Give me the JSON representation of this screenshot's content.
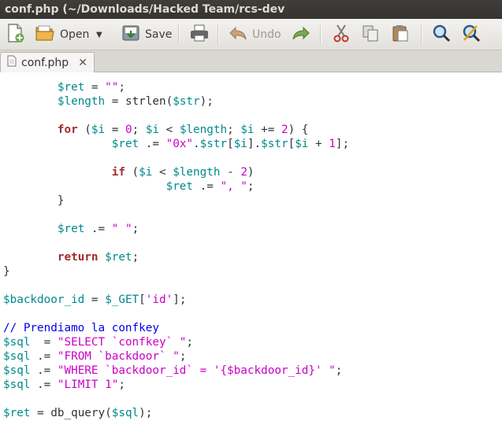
{
  "window": {
    "title": "conf.php (~/Downloads/Hacked Team/rcs-dev"
  },
  "toolbar": {
    "open_label": "Open",
    "save_label": "Save",
    "undo_label": "Undo"
  },
  "tab": {
    "label": "conf.php"
  },
  "editor": {
    "language": "php",
    "lines": [
      "        $ret = \"\";",
      "        $length = strlen($str);",
      "",
      "        for ($i = 0; $i < $length; $i += 2) {",
      "                $ret .= \"0x\".$str[$i].$str[$i + 1];",
      "",
      "                if ($i < $length - 2)",
      "                        $ret .= \", \";",
      "        }",
      "",
      "        $ret .= \" \";",
      "",
      "        return $ret;",
      "}",
      "",
      "$backdoor_id = $_GET['id'];",
      "",
      "// Prendiamo la confkey",
      "$sql  = \"SELECT `confkey` \";",
      "$sql .= \"FROM `backdoor` \";",
      "$sql .= \"WHERE `backdoor_id` = '{$backdoor_id}' \";",
      "$sql .= \"LIMIT 1\";",
      "",
      "$ret = db_query($sql);"
    ]
  },
  "colors": {
    "variable": "#008a8c",
    "keyword": "#a52a2a",
    "string": "#c800c8",
    "comment": "#0000ee",
    "titlebar": "#3c3b37"
  }
}
